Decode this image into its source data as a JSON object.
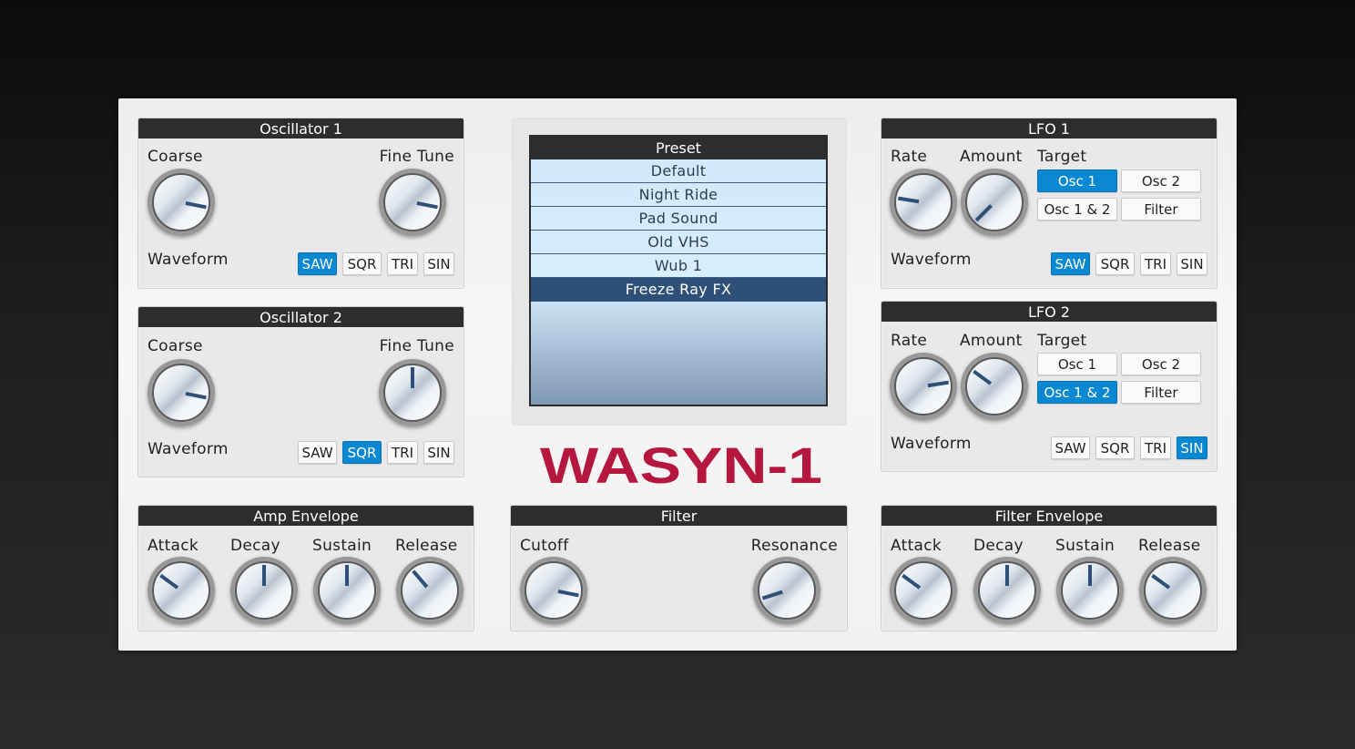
{
  "osc1": {
    "title": "Oscillator 1",
    "coarse_label": "Coarse",
    "fine_label": "Fine Tune",
    "waveform_label": "Waveform",
    "waveforms": [
      "SAW",
      "SQR",
      "TRI",
      "SIN"
    ],
    "selected_waveform": "SAW"
  },
  "osc2": {
    "title": "Oscillator 2",
    "coarse_label": "Coarse",
    "fine_label": "Fine Tune",
    "waveform_label": "Waveform",
    "waveforms": [
      "SAW",
      "SQR",
      "TRI",
      "SIN"
    ],
    "selected_waveform": "SQR"
  },
  "preset": {
    "title": "Preset",
    "items": [
      "Default",
      "Night Ride",
      "Pad Sound",
      "Old VHS",
      "Wub 1",
      "Freeze Ray FX"
    ],
    "selected": "Freeze Ray FX"
  },
  "logo": {
    "text": "WASYN-1",
    "color": "#b5173f"
  },
  "lfo1": {
    "title": "LFO 1",
    "rate_label": "Rate",
    "amount_label": "Amount",
    "target_label": "Target",
    "targets": [
      "Osc 1",
      "Osc 2",
      "Osc 1 & 2",
      "Filter"
    ],
    "selected_target": "Osc 1",
    "waveform_label": "Waveform",
    "waveforms": [
      "SAW",
      "SQR",
      "TRI",
      "SIN"
    ],
    "selected_waveform": "SAW"
  },
  "lfo2": {
    "title": "LFO 2",
    "rate_label": "Rate",
    "amount_label": "Amount",
    "target_label": "Target",
    "targets": [
      "Osc 1",
      "Osc 2",
      "Osc 1 & 2",
      "Filter"
    ],
    "selected_target": "Osc 1 & 2",
    "waveform_label": "Waveform",
    "waveforms": [
      "SAW",
      "SQR",
      "TRI",
      "SIN"
    ],
    "selected_waveform": "SIN"
  },
  "amp_env": {
    "title": "Amp Envelope",
    "attack_label": "Attack",
    "decay_label": "Decay",
    "sustain_label": "Sustain",
    "release_label": "Release"
  },
  "filter": {
    "title": "Filter",
    "cutoff_label": "Cutoff",
    "resonance_label": "Resonance"
  },
  "filter_env": {
    "title": "Filter Envelope",
    "attack_label": "Attack",
    "decay_label": "Decay",
    "sustain_label": "Sustain",
    "release_label": "Release"
  },
  "knob_values": {
    "osc1_coarse": 0.875,
    "osc1_fine": 0.875,
    "osc2_coarse": 0.875,
    "osc2_fine": 0.5,
    "lfo1_rate": 0.2,
    "lfo1_amount": 0.0,
    "lfo2_rate": 0.8,
    "lfo2_amount": 0.3,
    "amp_attack": 0.3,
    "amp_decay": 0.5,
    "amp_sustain": 0.5,
    "amp_release": 0.35,
    "filter_cutoff": 0.875,
    "filter_resonance": 0.1,
    "fenv_attack": 0.3,
    "fenv_decay": 0.5,
    "fenv_sustain": 0.5,
    "fenv_release": 0.3
  },
  "colors": {
    "accent": "#0a88d2",
    "pointer": "#2e4f77",
    "panel_header": "#2d2d2d"
  }
}
